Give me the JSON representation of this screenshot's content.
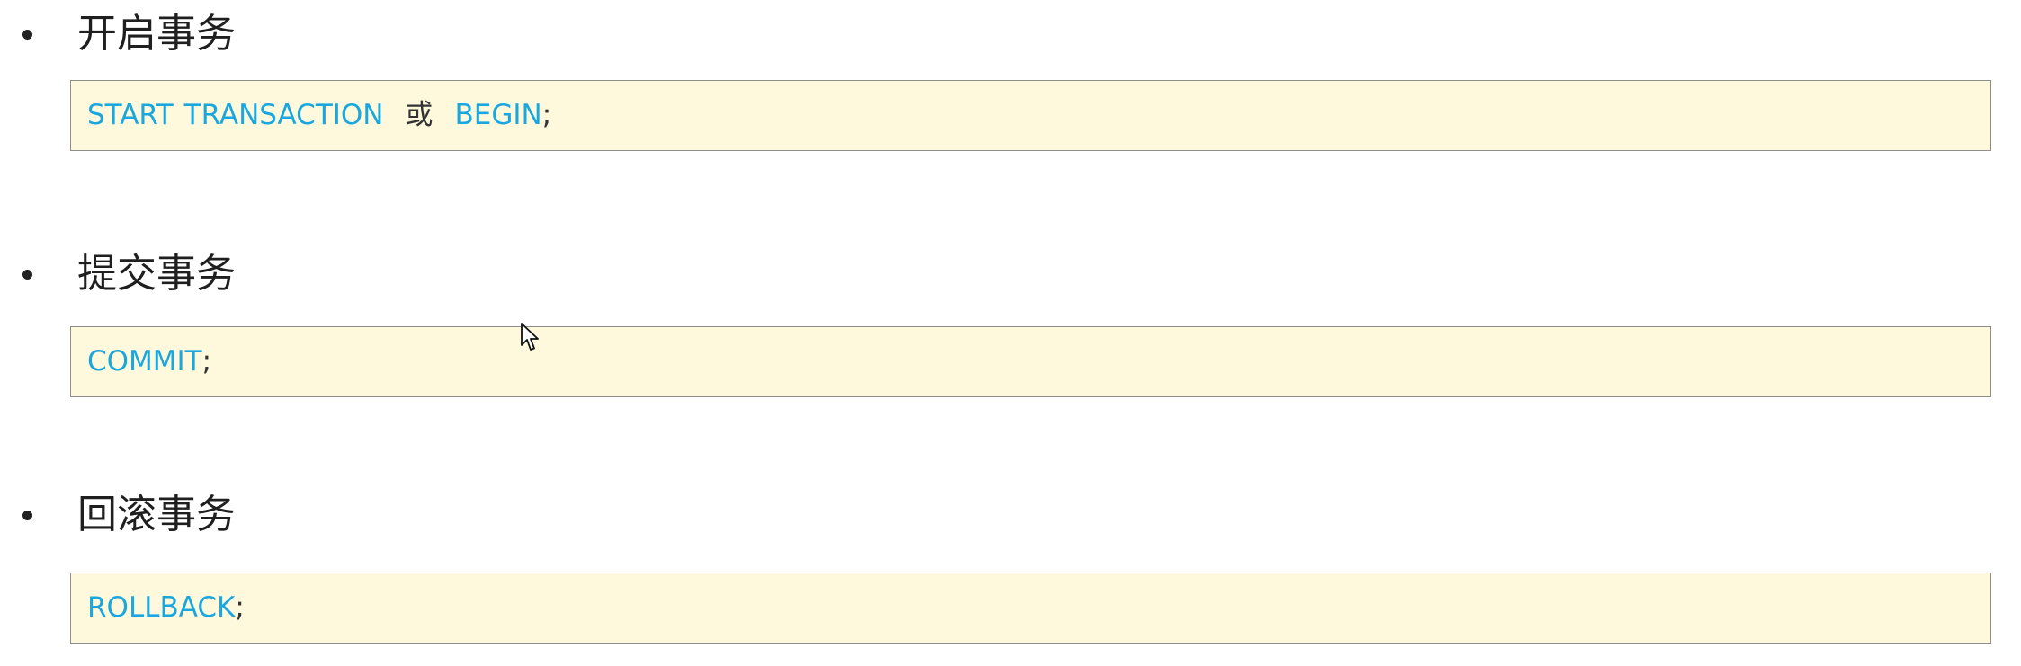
{
  "sections": [
    {
      "heading": "开启事务",
      "code": {
        "kw1": "START",
        "kw2": "TRANSACTION",
        "or": "或",
        "kw3": "BEGIN",
        "semi": ";"
      }
    },
    {
      "heading": "提交事务",
      "code": {
        "kw1": "COMMIT",
        "semi": ";"
      }
    },
    {
      "heading": "回滚事务",
      "code": {
        "kw1": "ROLLBACK",
        "semi": ";"
      }
    }
  ],
  "colors": {
    "keyword": "#1aa7de",
    "code_background": "#fef9dd",
    "code_border": "#8e8e8e",
    "heading_text": "#1f1f1f"
  },
  "icons": {
    "bullet": "bullet-dot-icon",
    "cursor": "mouse-pointer-icon"
  }
}
